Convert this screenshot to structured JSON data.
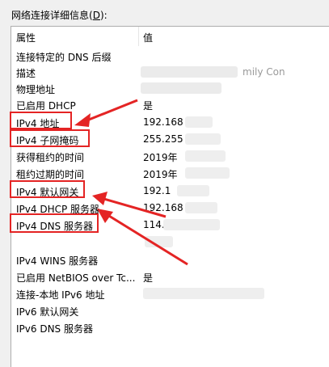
{
  "group_label": "网络连接详细信息(D):",
  "group_label_accel": "D",
  "columns": {
    "property": "属性",
    "value": "值"
  },
  "rows": [
    {
      "key": "连接特定的 DNS 后缀",
      "value": ""
    },
    {
      "key": "描述",
      "value": "mily Con"
    },
    {
      "key": "物理地址",
      "value": ""
    },
    {
      "key": "已启用 DHCP",
      "value": "是"
    },
    {
      "key": "IPv4 地址",
      "value": "192.168"
    },
    {
      "key": "IPv4 子网掩码",
      "value": "255.255"
    },
    {
      "key": "获得租约的时间",
      "value": "2019年"
    },
    {
      "key": "租约过期的时间",
      "value": "2019年"
    },
    {
      "key": "IPv4 默认网关",
      "value": "192.1"
    },
    {
      "key": "IPv4 DHCP 服务器",
      "value": "192.168"
    },
    {
      "key": "IPv4 DNS 服务器",
      "value": "114."
    },
    {
      "key": "",
      "value": ""
    },
    {
      "key": "IPv4 WINS 服务器",
      "value": ""
    },
    {
      "key": "已启用 NetBIOS over Tc...",
      "value": "是"
    },
    {
      "key": "连接-本地 IPv6 地址",
      "value": ""
    },
    {
      "key": "IPv6 默认网关",
      "value": ""
    },
    {
      "key": "IPv6 DNS 服务器",
      "value": ""
    }
  ],
  "colors": {
    "highlight": "#e42424",
    "list_bg": "#ffffff",
    "window_bg": "#f0f0f0"
  }
}
